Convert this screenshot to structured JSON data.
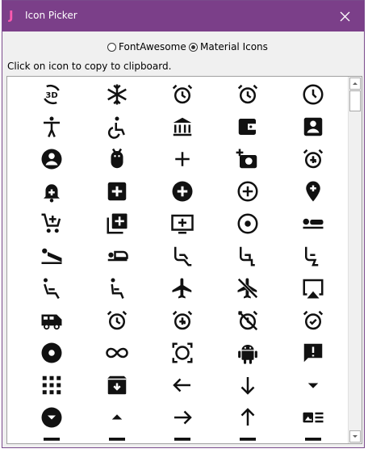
{
  "window": {
    "title": "Icon Picker",
    "app_icon": "J",
    "title_color": "#7b3f89",
    "app_icon_color": "#ff5ab0"
  },
  "options": {
    "fontawesome_label": "FontAwesome",
    "material_label": "Material Icons",
    "selected": "Material Icons"
  },
  "hint": "Click on icon to copy to clipboard.",
  "icons": [
    "3d-rotation-icon",
    "ac-unit-icon",
    "access-alarm-icon",
    "access-alarms-icon",
    "access-time-icon",
    "accessibility-icon",
    "accessible-icon",
    "account-balance-icon",
    "account-balance-wallet-icon",
    "account-box-icon",
    "account-circle-icon",
    "adb-icon",
    "add-icon",
    "add-a-photo-icon",
    "add-alarm-icon",
    "add-alert-icon",
    "add-box-icon",
    "add-circle-icon",
    "add-circle-outline-icon",
    "add-location-icon",
    "add-shopping-cart-icon",
    "add-to-photos-icon",
    "add-to-queue-icon",
    "adjust-icon",
    "airline-seat-flat-icon",
    "airline-seat-flat-angled-icon",
    "airline-seat-individual-suite-icon",
    "airline-seat-legroom-extra-icon",
    "airline-seat-legroom-normal-icon",
    "airline-seat-legroom-reduced-icon",
    "airline-seat-recline-extra-icon",
    "airline-seat-recline-normal-icon",
    "airplanemode-active-icon",
    "airplanemode-inactive-icon",
    "airplay-icon",
    "airport-shuttle-icon",
    "alarm-icon",
    "alarm-add-icon",
    "alarm-off-icon",
    "alarm-on-icon",
    "album-icon",
    "all-inclusive-icon",
    "all-out-icon",
    "android-icon",
    "announcement-icon",
    "apps-icon",
    "archive-icon",
    "arrow-back-icon",
    "arrow-downward-icon",
    "arrow-drop-down-icon",
    "arrow-drop-down-circle-icon",
    "arrow-drop-up-icon",
    "arrow-forward-icon",
    "arrow-upward-icon",
    "art-track-icon",
    "partial-icon",
    "partial-icon",
    "partial-icon",
    "partial-icon",
    "partial-icon"
  ]
}
